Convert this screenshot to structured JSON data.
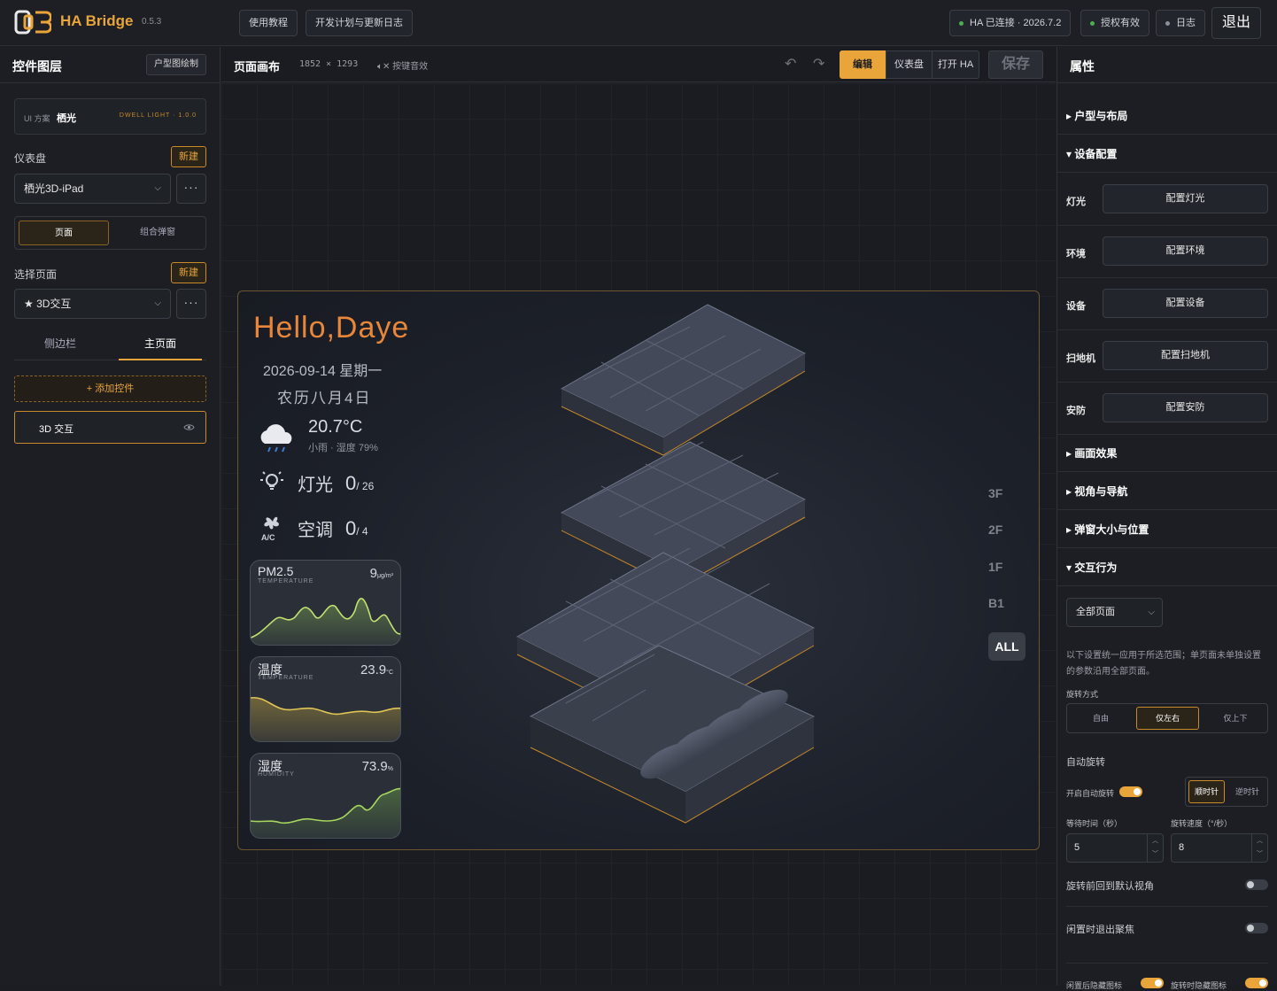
{
  "app": {
    "name": "HA Bridge",
    "version": "0.5.3",
    "accent": "#e9a53a"
  },
  "topbar": {
    "tutorial": "使用教程",
    "roadmap": "开发计划与更新日志",
    "ha_status": "HA 已连接 · 2026.7.2",
    "license": "授权有效",
    "log": "日志",
    "exit": "退出"
  },
  "left": {
    "title": "控件图层",
    "floorplan_btn": "户型图绘制",
    "scheme_prefix": "UI 方案",
    "scheme_name": "栖光",
    "scheme_tag": "DWELL LIGHT · 1.0.0",
    "dashboard_label": "仪表盘",
    "new": "新建",
    "dashboard_value": "栖光3D-iPad",
    "mode_tabs": [
      "页面",
      "组合弹窗"
    ],
    "page_label": "选择页面",
    "page_value": "★ 3D交互",
    "sub_tabs": [
      "侧边栏",
      "主页面"
    ],
    "add_widget": "+ 添加控件",
    "layer_item": "3D 交互"
  },
  "canvas": {
    "title": "页面画布",
    "size": "1852 × 1293",
    "sound": "按键音效",
    "modes": [
      "编辑",
      "仪表盘",
      "打开 HA"
    ],
    "save": "保存"
  },
  "dashboard": {
    "greeting": "Hello,Daye",
    "date": "2026-09-14 星期一",
    "lunar": "农历八月4日",
    "temp": "20.7°C",
    "weather": "小雨 · 湿度 79%",
    "light_label": "灯光",
    "light_on": "0",
    "light_total": "/ 26",
    "ac_label": "空调",
    "ac_on": "0",
    "ac_total": "/ 4",
    "cards": [
      {
        "title": "PM2.5",
        "sub": "TEMPERATURE",
        "value": "9",
        "unit": "μg/m³"
      },
      {
        "title": "温度",
        "sub": "TEMPERATURE",
        "value": "23.9",
        "unit": "°C"
      },
      {
        "title": "湿度",
        "sub": "HUMIDITY",
        "value": "73.9",
        "unit": "%"
      }
    ],
    "floors": [
      "3F",
      "2F",
      "1F",
      "B1"
    ],
    "floor_all": "ALL"
  },
  "right": {
    "title": "属性",
    "sections": {
      "layout": "户型与布局",
      "devices": "设备配置",
      "effects": "画面效果",
      "view": "视角与导航",
      "popup": "弹窗大小与位置",
      "interaction": "交互行为"
    },
    "device_rows": [
      {
        "label": "灯光",
        "btn": "配置灯光"
      },
      {
        "label": "环境",
        "btn": "配置环境"
      },
      {
        "label": "设备",
        "btn": "配置设备"
      },
      {
        "label": "扫地机",
        "btn": "配置扫地机"
      },
      {
        "label": "安防",
        "btn": "配置安防"
      }
    ],
    "scope": "全部页面",
    "note": "以下设置统一应用于所选范围；单页面未单独设置的参数沿用全部页面。",
    "rotate_mode_label": "旋转方式",
    "rotate_modes": [
      "自由",
      "仅左右",
      "仅上下"
    ],
    "auto_rotate": "自动旋转",
    "auto_rotate_toggle": "开启自动旋转",
    "directions": [
      "顺时针",
      "逆时针"
    ],
    "wait_label": "等待时间（秒）",
    "wait_value": "5",
    "speed_label": "旋转速度（°/秒）",
    "speed_value": "8",
    "reset_view": "旋转前回到默认视角",
    "idle_exit": "闲置时退出聚焦",
    "idle_hide": "闲置后隐藏图标",
    "rotate_hide": "旋转时隐藏图标"
  }
}
